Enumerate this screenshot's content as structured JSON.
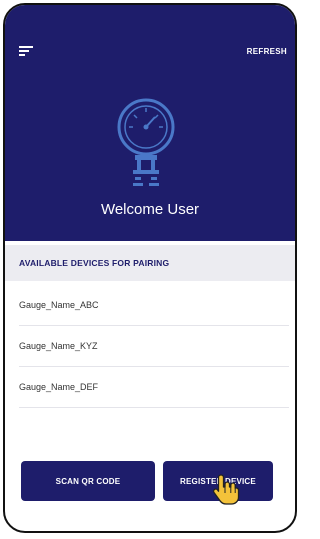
{
  "header": {
    "refresh_label": "REFRESH",
    "welcome_text": "Welcome User",
    "background_color": "#1e1d6b"
  },
  "devices": {
    "section_title": "AVAILABLE DEVICES FOR PAIRING",
    "items": [
      {
        "label": "Gauge_Name_ABC"
      },
      {
        "label": "Gauge_Name_KYZ"
      },
      {
        "label": "Gauge_Name_DEF"
      }
    ]
  },
  "actions": {
    "scan_label": "SCAN QR CODE",
    "register_label": "REGISTER DEVICE"
  },
  "icons": {
    "menu": "menu-icon",
    "gauge": "pressure-gauge-icon",
    "cursor": "hand-pointer-icon"
  }
}
